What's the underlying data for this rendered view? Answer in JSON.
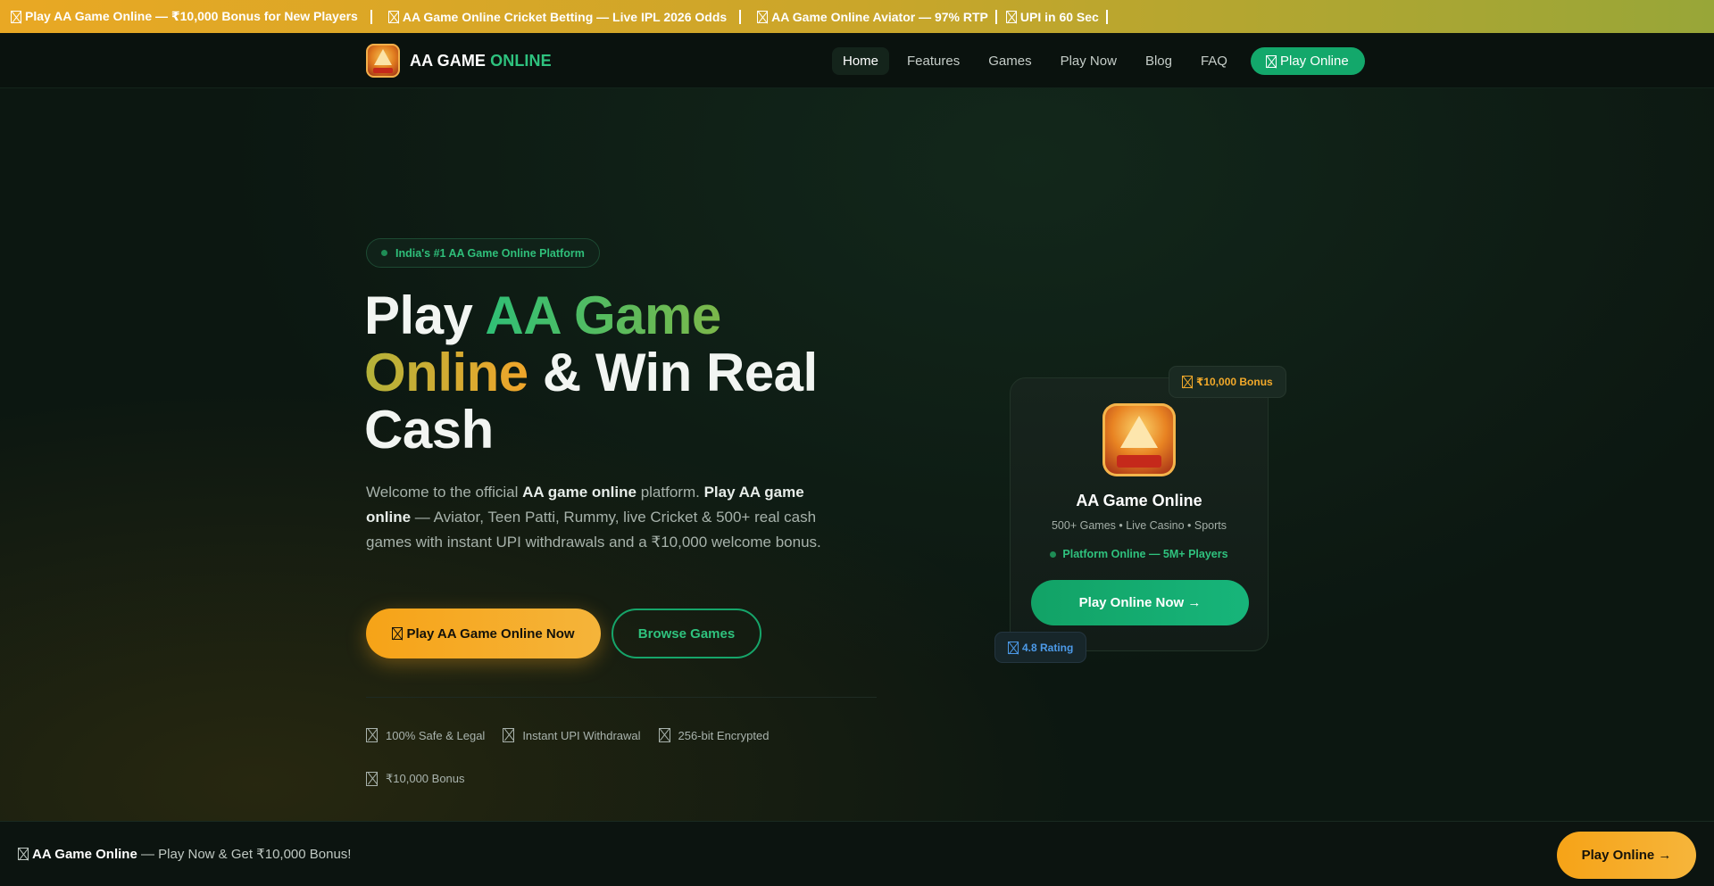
{
  "ticker": {
    "items": [
      "Play AA Game Online — ₹10,000 Bonus for New Players",
      "AA Game Online Cricket Betting — Live IPL 2026 Odds",
      "AA Game Online Aviator — 97% RTP",
      "UPI in 60 Sec"
    ]
  },
  "header": {
    "brand": "AA GAME",
    "brand_accent": "ONLINE",
    "nav": [
      "Home",
      "Features",
      "Games",
      "Play Now",
      "Blog",
      "FAQ"
    ],
    "cta": "Play Online"
  },
  "hero": {
    "pill": "India's #1 AA Game Online Platform",
    "h1_part1": "Play ",
    "h1_green": "AA Game",
    "h1_gold": "Online",
    "h1_part2": " & Win Real Cash",
    "lead_1": "Welcome to the official ",
    "lead_b1": "AA game online",
    "lead_2": " platform. ",
    "lead_b2": "Play AA game online",
    "lead_3": " — Aviator, Teen Patti, Rummy, live Cricket & 500+ real cash games with instant UPI withdrawals and a ₹10,000 welcome bonus.",
    "btn_primary": "Play AA Game Online Now",
    "btn_outline": "Browse Games",
    "trust": [
      "100% Safe & Legal",
      "Instant UPI Withdrawal",
      "256-bit Encrypted",
      "₹10,000 Bonus"
    ]
  },
  "card": {
    "title": "AA Game Online",
    "subtitle": "500+ Games • Live Casino • Sports",
    "status": "Platform Online — 5M+ Players",
    "button": "Play Online Now →",
    "bonus_badge": "₹10,000 Bonus",
    "rating_badge": "4.8 Rating"
  },
  "sticky": {
    "brand": "AA Game Online",
    "text": " — Play Now & Get ₹10,000 Bonus!",
    "button": "Play Online →"
  },
  "colors": {
    "accent_green": "#13a86b",
    "accent_gold": "#f6a317",
    "background": "#0c1711"
  }
}
